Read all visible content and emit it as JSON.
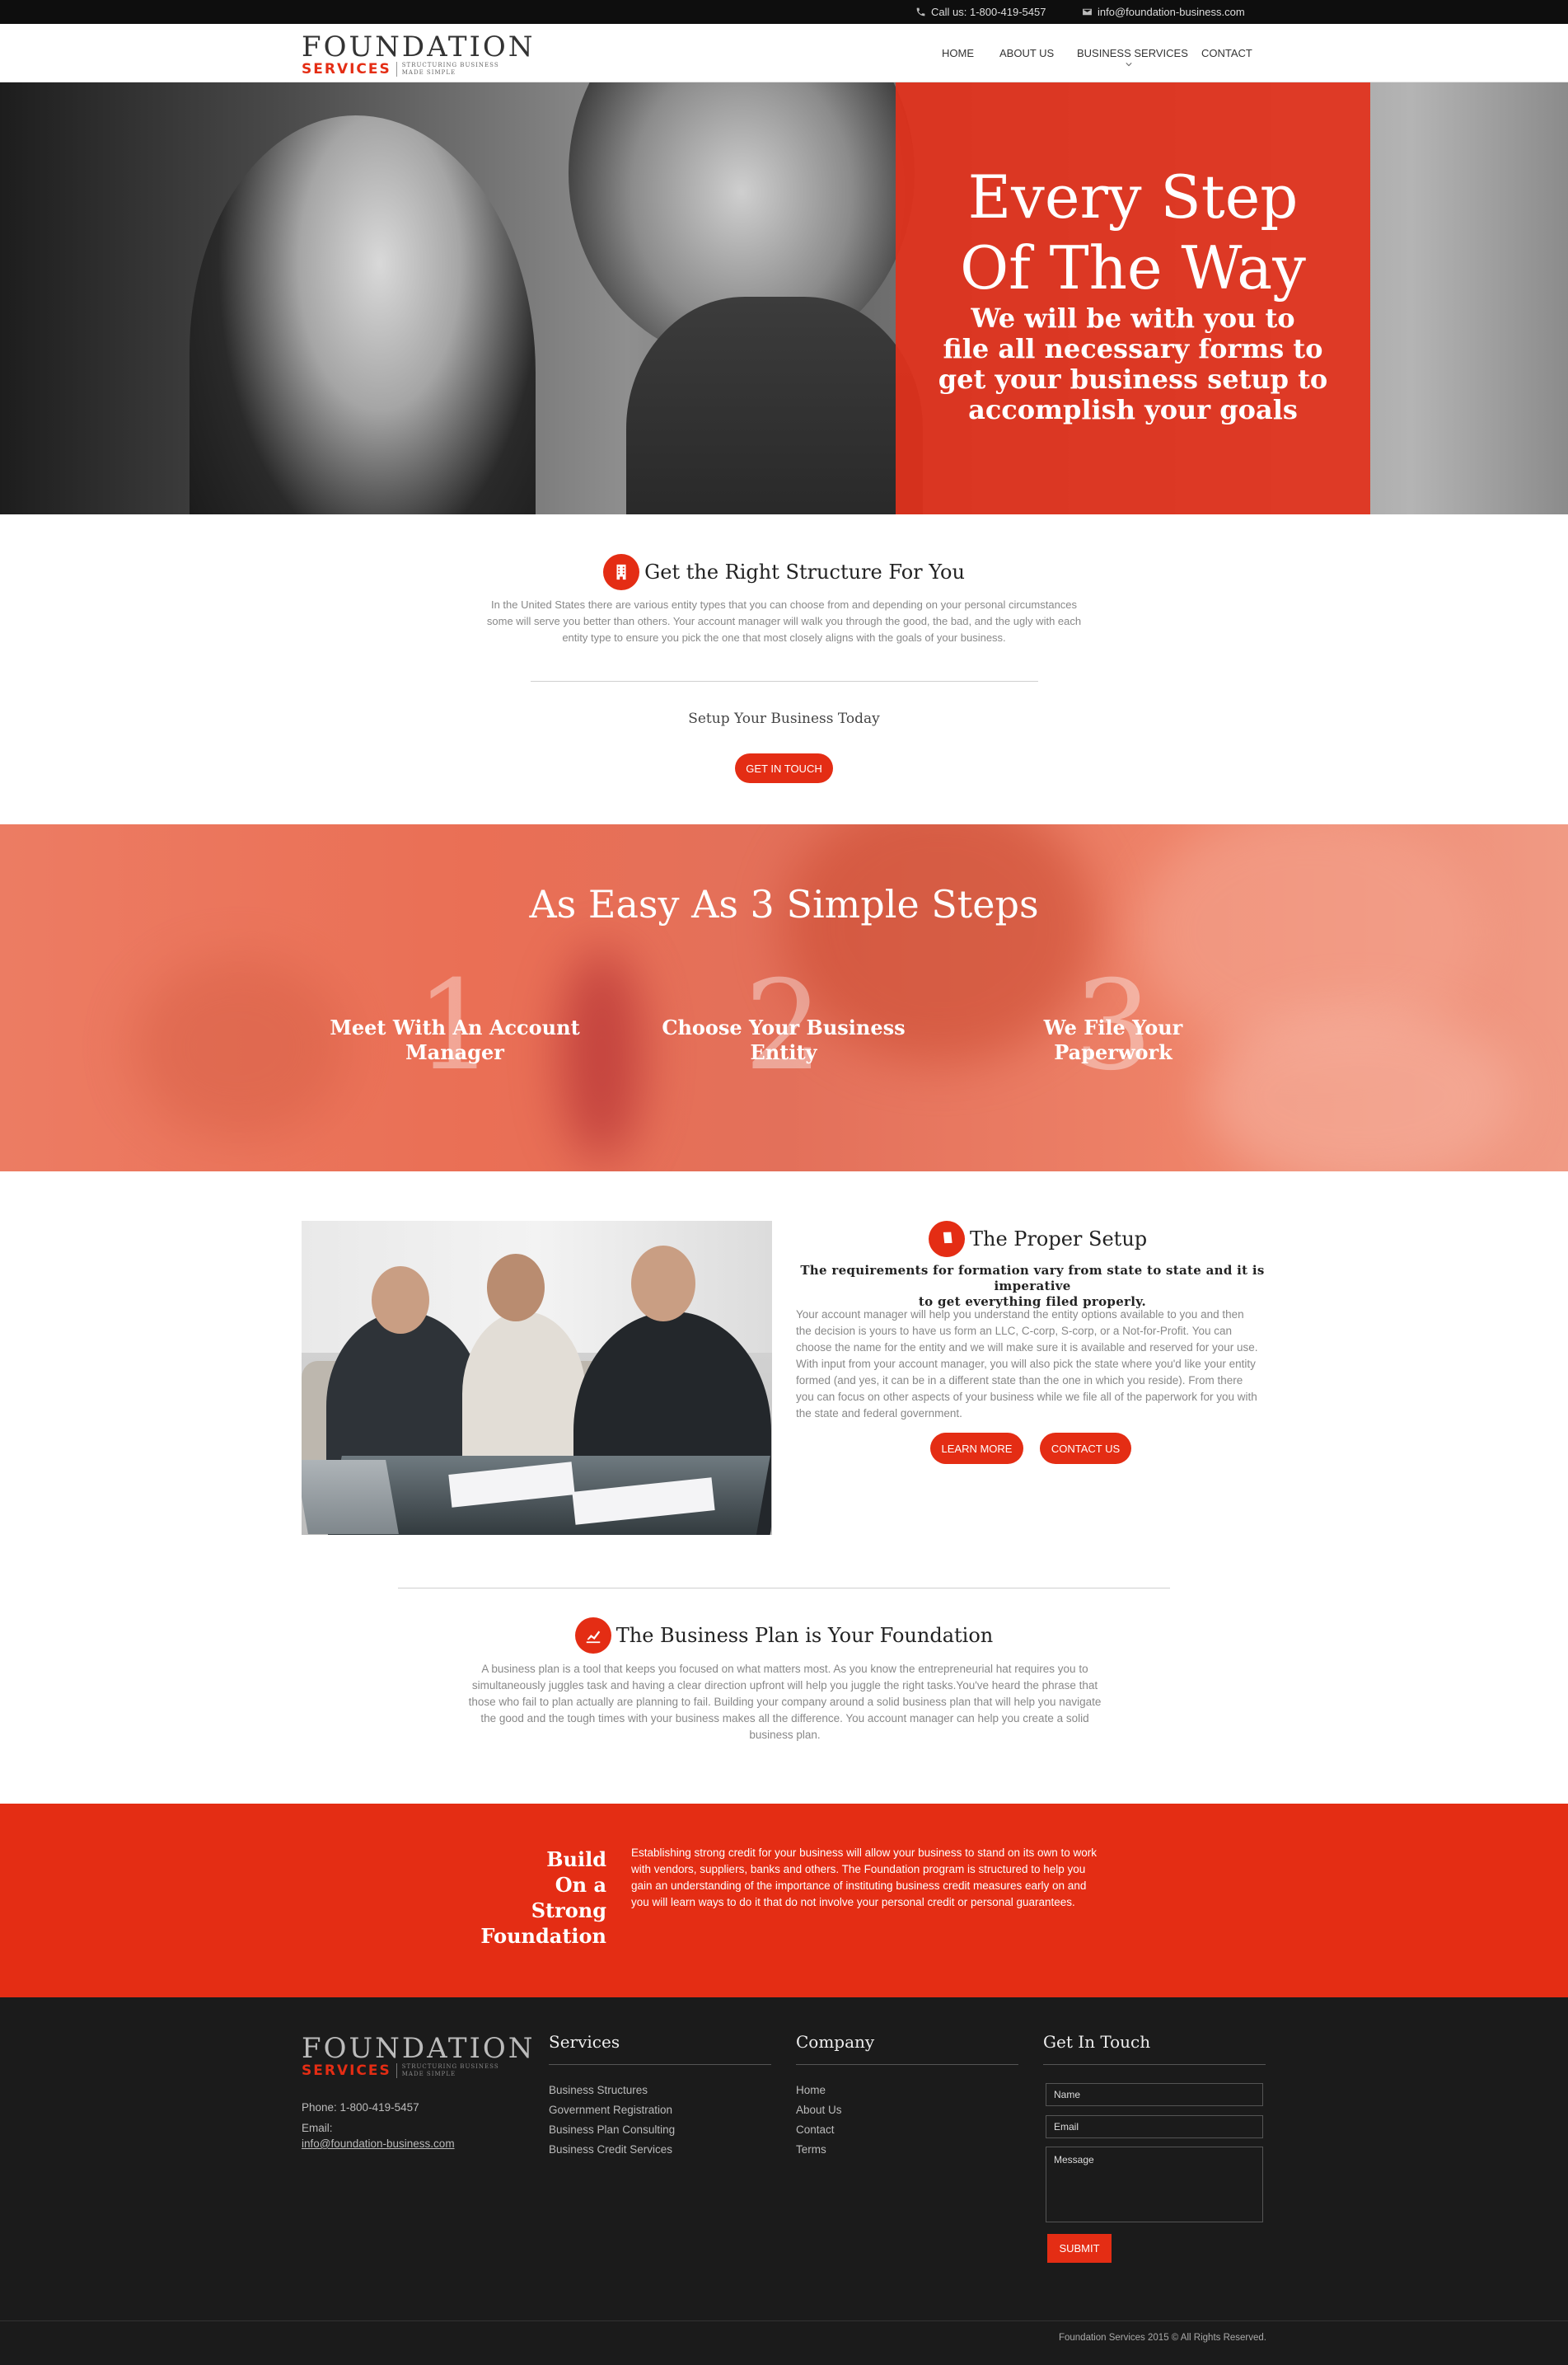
{
  "topbar": {
    "phone": "Call us: 1-800-419-5457",
    "email": "info@foundation-business.com"
  },
  "brand": {
    "name": "FOUNDATION",
    "sub": "SERVICES",
    "tagline_1": "STRUCTURING BUSINESS",
    "tagline_2": "MADE SIMPLE",
    "accent_color": "#e42d14"
  },
  "nav": {
    "items": [
      "HOME",
      "ABOUT US",
      "BUSINESS SERVICES",
      "CONTACT"
    ]
  },
  "hero": {
    "title_1": "Every Step",
    "title_2": "Of The Way",
    "sub_1": "We will be with you to",
    "sub_2": "file all necessary forms to",
    "sub_3": "get your business setup to",
    "sub_4": "accomplish your goals"
  },
  "structure": {
    "title": "Get the Right Structure For You",
    "icon": "building-icon",
    "line_1": "In the United States there are various entity types that you can choose from and depending on your personal circumstances",
    "line_2": "some will serve you better than others. Your account manager will walk you through the good, the bad, and the ugly with each",
    "line_3": "entity type to ensure you pick the one that most closely aligns with the goals of your business.",
    "setup_text": "Setup Your Business Today",
    "button": "GET IN TOUCH"
  },
  "steps": {
    "title": "As Easy As 3 Simple Steps",
    "items": [
      {
        "num": "1",
        "line_1": "Meet With An Account Manager",
        "line_2": ""
      },
      {
        "num": "2",
        "line_1": "Choose Your Business",
        "line_2": "Entity"
      },
      {
        "num": "3",
        "line_1": "We File Your",
        "line_2": "Paperwork"
      }
    ]
  },
  "proper_setup": {
    "title": "The Proper Setup",
    "icon": "document-icon",
    "lead_1": "The requirements for formation vary from state to state and it is imperative",
    "lead_2": "to get everything filed properly.",
    "body": "Your account manager will help you understand the entity options available to you and then the decision is yours to have us form an LLC, C-corp, S-corp, or a Not-for-Profit. You can choose the name for the entity and we will make sure it is available and reserved for your use. With input from your account manager, you will also pick the state where you'd like your entity formed (and yes, it can be in a different state than the one in which you reside). From there you can focus on other aspects of your business while we file all of the paperwork for you with the state and federal government.",
    "button_1": "LEARN MORE",
    "button_2": "CONTACT US"
  },
  "business_plan": {
    "title": "The Business Plan is Your Foundation",
    "icon": "chart-icon",
    "body": "A business plan is a tool that keeps you focused on what matters most. As you know the entrepreneurial hat requires you to simultaneously juggles task and having a clear direction upfront will help you juggle the right tasks.You've heard the phrase that those who fail to plan actually are planning to fail. Building your company around a solid business plan that will help you navigate the good and the tough times with your business makes all the difference. You account manager can help you create a solid business plan."
  },
  "build": {
    "title_1": "Build",
    "title_2": "On a",
    "title_3": "Strong",
    "title_4": "Foundation",
    "body": "Establishing strong credit for your business will allow your business to stand on its own to work with vendors, suppliers, banks and others. The Foundation program is structured to help you gain an understanding of the importance of instituting business credit measures early on and you will learn ways to do it that do not involve your personal credit or personal guarantees."
  },
  "footer": {
    "phone": "Phone: 1-800-419-5457",
    "email_label": "Email:",
    "email": "info@foundation-business.com",
    "services_title": "Services",
    "services": [
      "Business Structures",
      "Government Registration",
      "Business Plan Consulting",
      "Business Credit Services"
    ],
    "company_title": "Company",
    "company": [
      "Home",
      "About Us",
      "Contact",
      "Terms"
    ],
    "contact_title": "Get In Touch",
    "name_placeholder": "Name",
    "email_placeholder": "Email",
    "message_placeholder": "Message",
    "submit": "SUBMIT",
    "copyright": "Foundation Services 2015 © All Rights Reserved."
  }
}
